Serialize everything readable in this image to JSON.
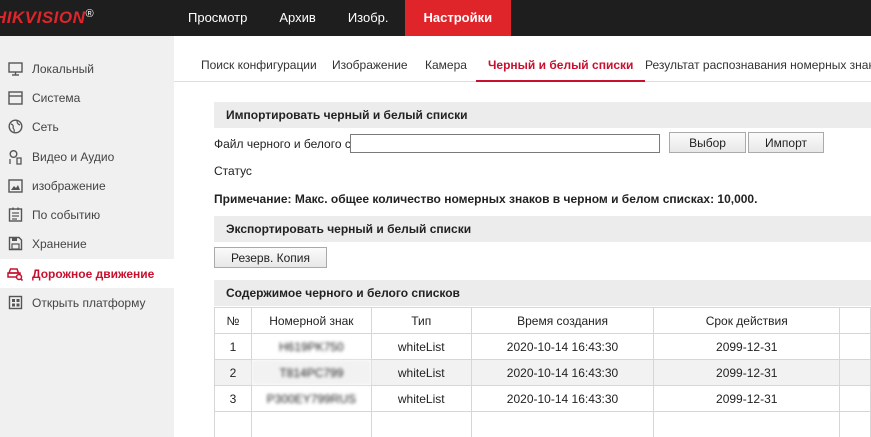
{
  "header": {
    "logo_brand": "HIKVISION",
    "logo_mark": "®",
    "nav": [
      {
        "label": "Просмотр"
      },
      {
        "label": "Архив"
      },
      {
        "label": "Изобр."
      },
      {
        "label": "Настройки",
        "active": true
      }
    ]
  },
  "sidebar": {
    "items": [
      {
        "label": "Локальный",
        "icon": "monitor-icon"
      },
      {
        "label": "Система",
        "icon": "system-icon"
      },
      {
        "label": "Сеть",
        "icon": "globe-icon"
      },
      {
        "label": "Видео и Аудио",
        "icon": "video-audio-icon"
      },
      {
        "label": "изображение",
        "icon": "image-icon"
      },
      {
        "label": "По событию",
        "icon": "event-icon"
      },
      {
        "label": "Хранение",
        "icon": "storage-icon"
      },
      {
        "label": "Дорожное движение",
        "icon": "traffic-icon",
        "active": true
      },
      {
        "label": "Открыть платформу",
        "icon": "platform-icon"
      }
    ]
  },
  "subtabs": [
    {
      "label": "Поиск конфигурации"
    },
    {
      "label": "Изображение"
    },
    {
      "label": "Камера"
    },
    {
      "label": "Черный и белый списки",
      "active": true
    },
    {
      "label": "Результат распознавания номерных знаков"
    }
  ],
  "import": {
    "title": "Импортировать черный и белый списки",
    "file_label": "Файл черного и белого с...",
    "file_value": "",
    "browse_button": "Выбор",
    "import_button": "Импорт",
    "status_label": "Статус"
  },
  "note": "Примечание: Макс. общее количество номерных знаков в черном и белом списках: 10,000.",
  "export": {
    "title": "Экспортировать черный и белый списки",
    "backup_button": "Резерв. Копия"
  },
  "list": {
    "title": "Содержимое черного и белого списков",
    "columns": [
      "№",
      "Номерной знак",
      "Тип",
      "Время создания",
      "Срок действия"
    ],
    "rows": [
      {
        "num": "1",
        "plate": "H619PK750",
        "type": "whiteList",
        "created": "2020-10-14 16:43:30",
        "expires": "2099-12-31"
      },
      {
        "num": "2",
        "plate": "T814PC799",
        "type": "whiteList",
        "created": "2020-10-14 16:43:30",
        "expires": "2099-12-31"
      },
      {
        "num": "3",
        "plate": "P300EY799RUS",
        "type": "whiteList",
        "created": "2020-10-14 16:43:30",
        "expires": "2099-12-31"
      }
    ]
  },
  "colors": {
    "accent": "#e0252a",
    "topbar": "#1e1e1e",
    "sidebar": "#f0f0f0"
  }
}
